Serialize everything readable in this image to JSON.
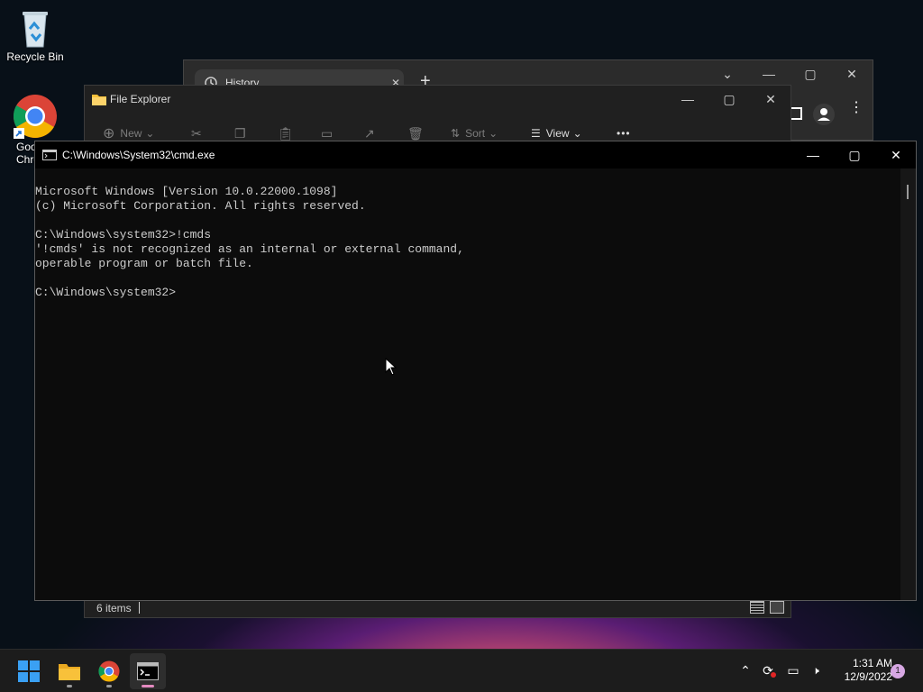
{
  "desktop": {
    "recycle_bin_label": "Recycle Bin",
    "chrome_label_line1": "Goo",
    "chrome_label_line2": "Chro"
  },
  "browser": {
    "tab_title": "History",
    "new_tab": "+"
  },
  "explorer": {
    "title": "File Explorer",
    "new_label": "New",
    "sort_label": "Sort",
    "view_label": "View",
    "more": "•••",
    "status_items": "6 items"
  },
  "cmd": {
    "title": "C:\\Windows\\System32\\cmd.exe",
    "lines": [
      "Microsoft Windows [Version 10.0.22000.1098]",
      "(c) Microsoft Corporation. All rights reserved.",
      "",
      "C:\\Windows\\system32>!cmds",
      "'!cmds' is not recognized as an internal or external command,",
      "operable program or batch file.",
      "",
      "C:\\Windows\\system32>"
    ]
  },
  "taskbar": {
    "time": "1:31 AM",
    "date": "12/9/2022",
    "notification_count": "1"
  },
  "colors": {
    "accent": "#0078d4",
    "chrome_red": "#db4437",
    "chrome_yellow": "#f4b400",
    "chrome_green": "#0f9d58",
    "folder_yellow": "#f8c13a"
  }
}
